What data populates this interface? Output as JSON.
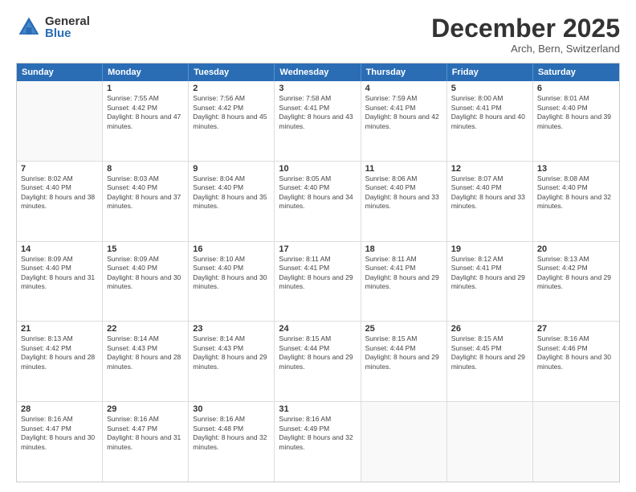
{
  "logo": {
    "general": "General",
    "blue": "Blue"
  },
  "title": "December 2025",
  "location": "Arch, Bern, Switzerland",
  "header_days": [
    "Sunday",
    "Monday",
    "Tuesday",
    "Wednesday",
    "Thursday",
    "Friday",
    "Saturday"
  ],
  "weeks": [
    [
      {
        "day": "",
        "sunrise": "",
        "sunset": "",
        "daylight": "",
        "empty": true
      },
      {
        "day": "1",
        "sunrise": "Sunrise: 7:55 AM",
        "sunset": "Sunset: 4:42 PM",
        "daylight": "Daylight: 8 hours and 47 minutes.",
        "empty": false
      },
      {
        "day": "2",
        "sunrise": "Sunrise: 7:56 AM",
        "sunset": "Sunset: 4:42 PM",
        "daylight": "Daylight: 8 hours and 45 minutes.",
        "empty": false
      },
      {
        "day": "3",
        "sunrise": "Sunrise: 7:58 AM",
        "sunset": "Sunset: 4:41 PM",
        "daylight": "Daylight: 8 hours and 43 minutes.",
        "empty": false
      },
      {
        "day": "4",
        "sunrise": "Sunrise: 7:59 AM",
        "sunset": "Sunset: 4:41 PM",
        "daylight": "Daylight: 8 hours and 42 minutes.",
        "empty": false
      },
      {
        "day": "5",
        "sunrise": "Sunrise: 8:00 AM",
        "sunset": "Sunset: 4:41 PM",
        "daylight": "Daylight: 8 hours and 40 minutes.",
        "empty": false
      },
      {
        "day": "6",
        "sunrise": "Sunrise: 8:01 AM",
        "sunset": "Sunset: 4:40 PM",
        "daylight": "Daylight: 8 hours and 39 minutes.",
        "empty": false
      }
    ],
    [
      {
        "day": "7",
        "sunrise": "Sunrise: 8:02 AM",
        "sunset": "Sunset: 4:40 PM",
        "daylight": "Daylight: 8 hours and 38 minutes.",
        "empty": false
      },
      {
        "day": "8",
        "sunrise": "Sunrise: 8:03 AM",
        "sunset": "Sunset: 4:40 PM",
        "daylight": "Daylight: 8 hours and 37 minutes.",
        "empty": false
      },
      {
        "day": "9",
        "sunrise": "Sunrise: 8:04 AM",
        "sunset": "Sunset: 4:40 PM",
        "daylight": "Daylight: 8 hours and 35 minutes.",
        "empty": false
      },
      {
        "day": "10",
        "sunrise": "Sunrise: 8:05 AM",
        "sunset": "Sunset: 4:40 PM",
        "daylight": "Daylight: 8 hours and 34 minutes.",
        "empty": false
      },
      {
        "day": "11",
        "sunrise": "Sunrise: 8:06 AM",
        "sunset": "Sunset: 4:40 PM",
        "daylight": "Daylight: 8 hours and 33 minutes.",
        "empty": false
      },
      {
        "day": "12",
        "sunrise": "Sunrise: 8:07 AM",
        "sunset": "Sunset: 4:40 PM",
        "daylight": "Daylight: 8 hours and 33 minutes.",
        "empty": false
      },
      {
        "day": "13",
        "sunrise": "Sunrise: 8:08 AM",
        "sunset": "Sunset: 4:40 PM",
        "daylight": "Daylight: 8 hours and 32 minutes.",
        "empty": false
      }
    ],
    [
      {
        "day": "14",
        "sunrise": "Sunrise: 8:09 AM",
        "sunset": "Sunset: 4:40 PM",
        "daylight": "Daylight: 8 hours and 31 minutes.",
        "empty": false
      },
      {
        "day": "15",
        "sunrise": "Sunrise: 8:09 AM",
        "sunset": "Sunset: 4:40 PM",
        "daylight": "Daylight: 8 hours and 30 minutes.",
        "empty": false
      },
      {
        "day": "16",
        "sunrise": "Sunrise: 8:10 AM",
        "sunset": "Sunset: 4:40 PM",
        "daylight": "Daylight: 8 hours and 30 minutes.",
        "empty": false
      },
      {
        "day": "17",
        "sunrise": "Sunrise: 8:11 AM",
        "sunset": "Sunset: 4:41 PM",
        "daylight": "Daylight: 8 hours and 29 minutes.",
        "empty": false
      },
      {
        "day": "18",
        "sunrise": "Sunrise: 8:11 AM",
        "sunset": "Sunset: 4:41 PM",
        "daylight": "Daylight: 8 hours and 29 minutes.",
        "empty": false
      },
      {
        "day": "19",
        "sunrise": "Sunrise: 8:12 AM",
        "sunset": "Sunset: 4:41 PM",
        "daylight": "Daylight: 8 hours and 29 minutes.",
        "empty": false
      },
      {
        "day": "20",
        "sunrise": "Sunrise: 8:13 AM",
        "sunset": "Sunset: 4:42 PM",
        "daylight": "Daylight: 8 hours and 29 minutes.",
        "empty": false
      }
    ],
    [
      {
        "day": "21",
        "sunrise": "Sunrise: 8:13 AM",
        "sunset": "Sunset: 4:42 PM",
        "daylight": "Daylight: 8 hours and 28 minutes.",
        "empty": false
      },
      {
        "day": "22",
        "sunrise": "Sunrise: 8:14 AM",
        "sunset": "Sunset: 4:43 PM",
        "daylight": "Daylight: 8 hours and 28 minutes.",
        "empty": false
      },
      {
        "day": "23",
        "sunrise": "Sunrise: 8:14 AM",
        "sunset": "Sunset: 4:43 PM",
        "daylight": "Daylight: 8 hours and 29 minutes.",
        "empty": false
      },
      {
        "day": "24",
        "sunrise": "Sunrise: 8:15 AM",
        "sunset": "Sunset: 4:44 PM",
        "daylight": "Daylight: 8 hours and 29 minutes.",
        "empty": false
      },
      {
        "day": "25",
        "sunrise": "Sunrise: 8:15 AM",
        "sunset": "Sunset: 4:44 PM",
        "daylight": "Daylight: 8 hours and 29 minutes.",
        "empty": false
      },
      {
        "day": "26",
        "sunrise": "Sunrise: 8:15 AM",
        "sunset": "Sunset: 4:45 PM",
        "daylight": "Daylight: 8 hours and 29 minutes.",
        "empty": false
      },
      {
        "day": "27",
        "sunrise": "Sunrise: 8:16 AM",
        "sunset": "Sunset: 4:46 PM",
        "daylight": "Daylight: 8 hours and 30 minutes.",
        "empty": false
      }
    ],
    [
      {
        "day": "28",
        "sunrise": "Sunrise: 8:16 AM",
        "sunset": "Sunset: 4:47 PM",
        "daylight": "Daylight: 8 hours and 30 minutes.",
        "empty": false
      },
      {
        "day": "29",
        "sunrise": "Sunrise: 8:16 AM",
        "sunset": "Sunset: 4:47 PM",
        "daylight": "Daylight: 8 hours and 31 minutes.",
        "empty": false
      },
      {
        "day": "30",
        "sunrise": "Sunrise: 8:16 AM",
        "sunset": "Sunset: 4:48 PM",
        "daylight": "Daylight: 8 hours and 32 minutes.",
        "empty": false
      },
      {
        "day": "31",
        "sunrise": "Sunrise: 8:16 AM",
        "sunset": "Sunset: 4:49 PM",
        "daylight": "Daylight: 8 hours and 32 minutes.",
        "empty": false
      },
      {
        "day": "",
        "sunrise": "",
        "sunset": "",
        "daylight": "",
        "empty": true
      },
      {
        "day": "",
        "sunrise": "",
        "sunset": "",
        "daylight": "",
        "empty": true
      },
      {
        "day": "",
        "sunrise": "",
        "sunset": "",
        "daylight": "",
        "empty": true
      }
    ]
  ]
}
